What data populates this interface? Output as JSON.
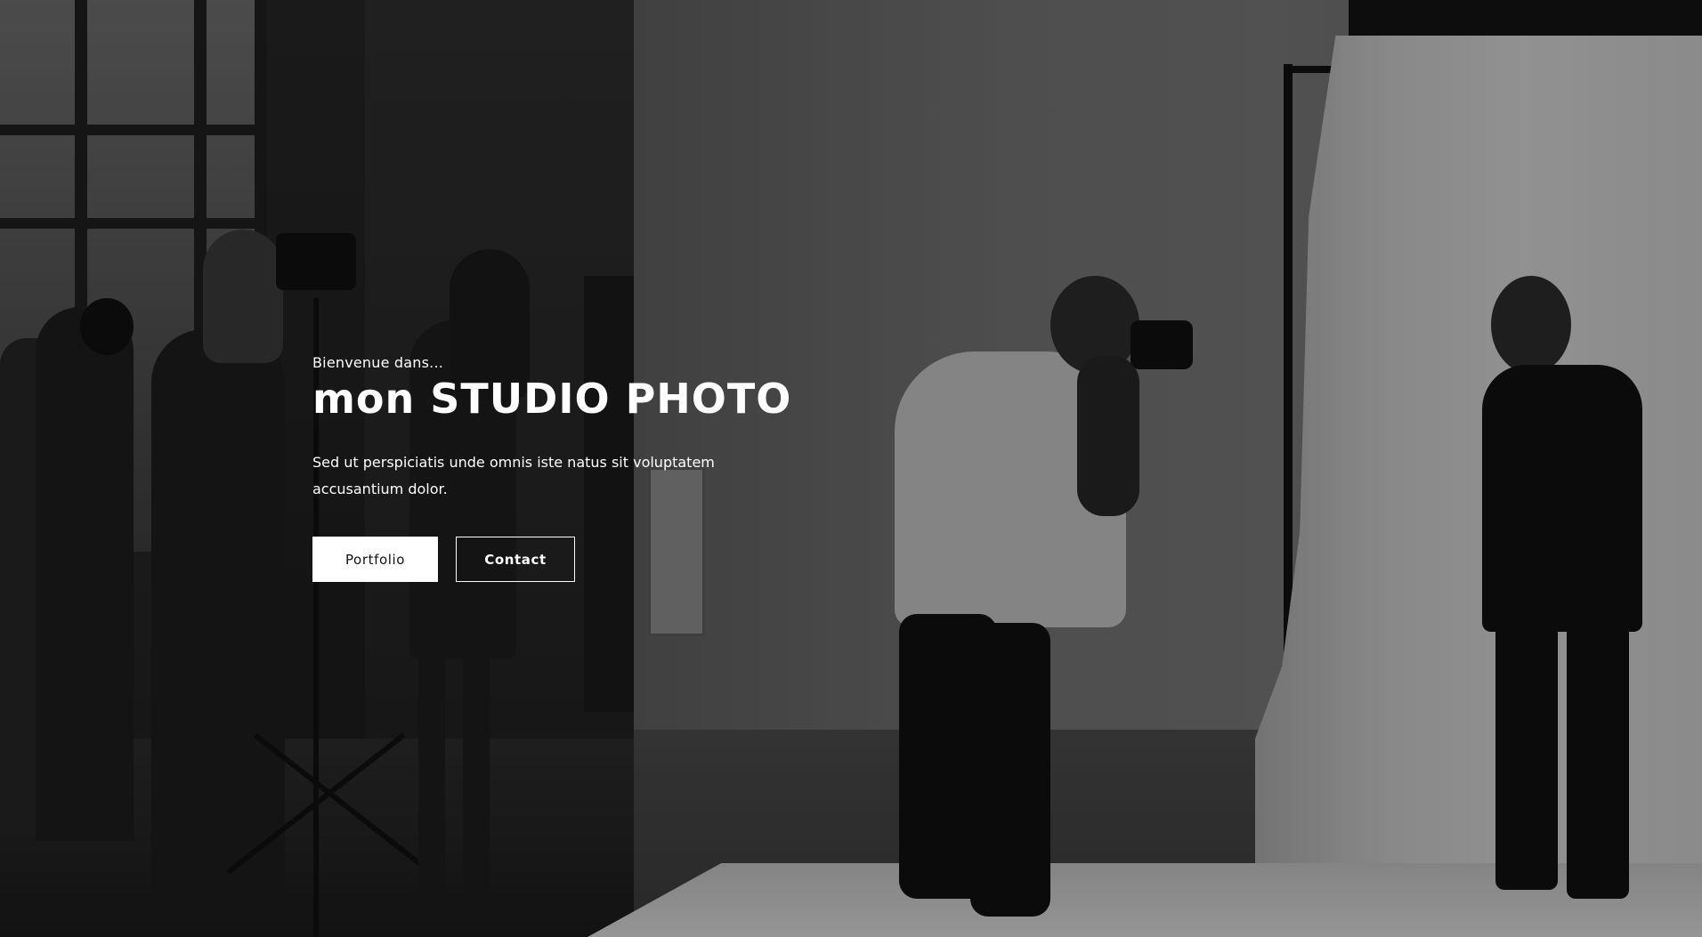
{
  "hero": {
    "kicker": "Bienvenue dans...",
    "title": "mon STUDIO PHOTO",
    "description": "Sed ut perspiciatis unde omnis iste natus sit voluptatem accusantium dolor.",
    "buttons": {
      "portfolio_label": "Portfolio",
      "contact_label": "Contact"
    }
  },
  "colors": {
    "text": "#ffffff",
    "primary_button_bg": "#ffffff",
    "primary_button_text": "#111111",
    "outline_button_border": "#ffffff"
  }
}
